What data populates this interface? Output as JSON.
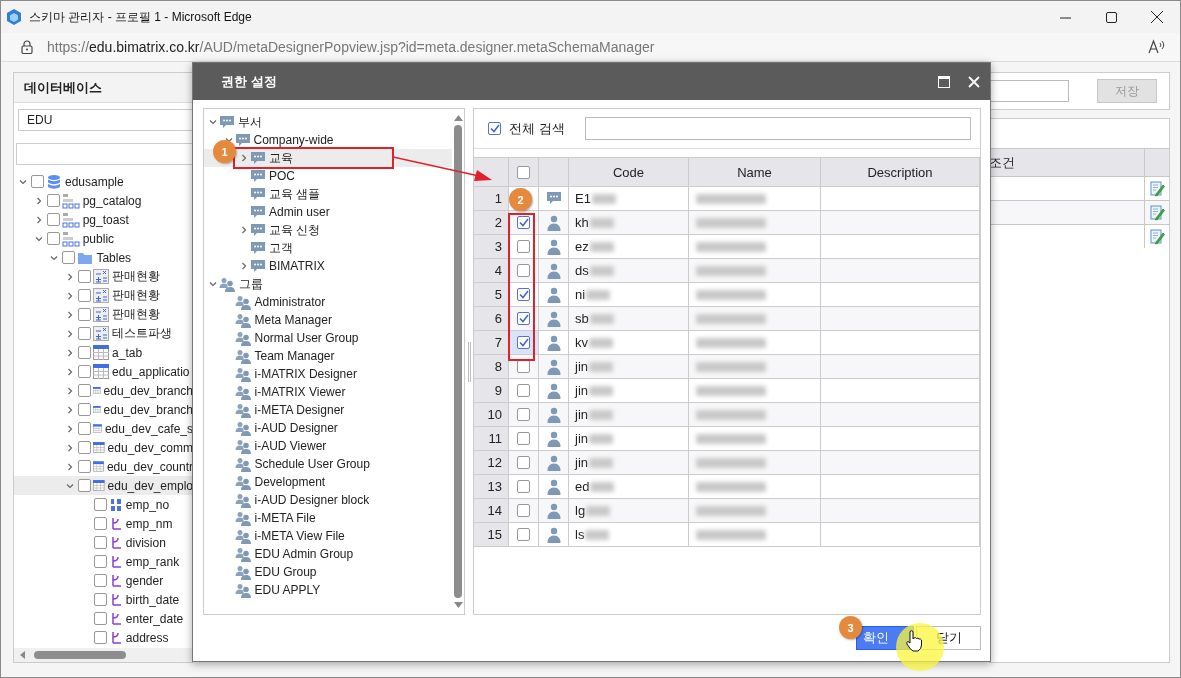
{
  "browser": {
    "title": "스키마 관리자 - 프로필 1 - Microsoft Edge",
    "url": {
      "scheme": "https://",
      "host": "edu.bimatrix.co.kr",
      "path": "/AUD/metaDesignerPopview.jsp?id=meta.designer.metaSchemaManager"
    }
  },
  "database_panel": {
    "title": "데이터베이스",
    "database": "EDU",
    "tree": [
      {
        "label": "edusample",
        "kind": "database",
        "checked": false,
        "expanded": true,
        "selected": false,
        "children": [
          {
            "label": "pg_catalog",
            "kind": "schema",
            "checked": false,
            "expanded": false,
            "selected": false
          },
          {
            "label": "pg_toast",
            "kind": "schema",
            "checked": false,
            "expanded": false,
            "selected": false
          },
          {
            "label": "public",
            "kind": "schema",
            "checked": false,
            "expanded": true,
            "selected": false,
            "children": [
              {
                "label": "Tables",
                "kind": "folder",
                "checked": false,
                "expanded": true,
                "selected": false,
                "children": [
                  {
                    "label": "판매현황",
                    "kind": "view",
                    "checked": false,
                    "expanded": false,
                    "selected": false
                  },
                  {
                    "label": "판매현황",
                    "kind": "view",
                    "checked": false,
                    "expanded": false,
                    "selected": false
                  },
                  {
                    "label": "판매현황",
                    "kind": "view",
                    "checked": false,
                    "expanded": false,
                    "selected": false
                  },
                  {
                    "label": "테스트파생",
                    "kind": "view",
                    "checked": false,
                    "expanded": false,
                    "selected": false
                  },
                  {
                    "label": "a_tab",
                    "kind": "table",
                    "checked": false,
                    "expanded": false,
                    "selected": false
                  },
                  {
                    "label": "edu_applicatio",
                    "kind": "table",
                    "checked": false,
                    "expanded": false,
                    "selected": false
                  },
                  {
                    "label": "edu_dev_branch",
                    "kind": "table",
                    "checked": false,
                    "expanded": false,
                    "selected": false
                  },
                  {
                    "label": "edu_dev_branch",
                    "kind": "table",
                    "checked": false,
                    "expanded": false,
                    "selected": false
                  },
                  {
                    "label": "edu_dev_cafe_s",
                    "kind": "table",
                    "checked": false,
                    "expanded": false,
                    "selected": false
                  },
                  {
                    "label": "edu_dev_comm",
                    "kind": "table",
                    "checked": false,
                    "expanded": false,
                    "selected": false
                  },
                  {
                    "label": "edu_dev_countr",
                    "kind": "table",
                    "checked": false,
                    "expanded": false,
                    "selected": false
                  },
                  {
                    "label": "edu_dev_emplo",
                    "kind": "table",
                    "checked": false,
                    "expanded": true,
                    "selected": true,
                    "children": [
                      {
                        "label": "emp_no",
                        "kind": "number",
                        "checked": false,
                        "selected": false
                      },
                      {
                        "label": "emp_nm",
                        "kind": "text",
                        "checked": false,
                        "selected": false
                      },
                      {
                        "label": "division",
                        "kind": "text",
                        "checked": false,
                        "selected": false
                      },
                      {
                        "label": "emp_rank",
                        "kind": "text",
                        "checked": false,
                        "selected": false
                      },
                      {
                        "label": "gender",
                        "kind": "text",
                        "checked": false,
                        "selected": false
                      },
                      {
                        "label": "birth_date",
                        "kind": "text",
                        "checked": false,
                        "selected": false
                      },
                      {
                        "label": "enter_date",
                        "kind": "text",
                        "checked": false,
                        "selected": false
                      },
                      {
                        "label": "address",
                        "kind": "text",
                        "checked": false,
                        "selected": false
                      }
                    ]
                  }
                ]
              }
            ]
          }
        ]
      }
    ]
  },
  "right_panel": {
    "save_button": "저장",
    "columns": [
      "조건"
    ],
    "rows": [
      {
        "editable": true
      },
      {
        "editable": true
      },
      {
        "editable": true
      }
    ]
  },
  "dialog": {
    "title": "권한 설정",
    "tree": [
      {
        "label": "부서",
        "kind": "department",
        "expanded": true,
        "selected": false,
        "children": [
          {
            "label": "Company-wide",
            "kind": "department",
            "expanded": true,
            "selected": false,
            "children": [
              {
                "label": "교육",
                "kind": "department",
                "expanded": false,
                "selected": true
              },
              {
                "label": "POC",
                "kind": "department",
                "selected": false
              },
              {
                "label": "교육 샘플",
                "kind": "department",
                "selected": false
              },
              {
                "label": "Admin user",
                "kind": "department",
                "selected": false
              },
              {
                "label": "교육 신청",
                "kind": "department",
                "expanded": false,
                "selected": false
              },
              {
                "label": "고객",
                "kind": "department",
                "selected": false
              },
              {
                "label": "BIMATRIX",
                "kind": "department",
                "expanded": false,
                "selected": false
              }
            ]
          }
        ]
      },
      {
        "label": "그룹",
        "kind": "group",
        "expanded": true,
        "selected": false,
        "children": [
          {
            "label": "Administrator",
            "kind": "group",
            "selected": false
          },
          {
            "label": "Meta Manager",
            "kind": "group",
            "selected": false
          },
          {
            "label": "Normal User Group",
            "kind": "group",
            "selected": false
          },
          {
            "label": "Team Manager",
            "kind": "group",
            "selected": false
          },
          {
            "label": "i-MATRIX Designer",
            "kind": "group",
            "selected": false
          },
          {
            "label": "i-MATRIX Viewer",
            "kind": "group",
            "selected": false
          },
          {
            "label": "i-META Designer",
            "kind": "group",
            "selected": false
          },
          {
            "label": "i-AUD Designer",
            "kind": "group",
            "selected": false
          },
          {
            "label": "i-AUD Viewer",
            "kind": "group",
            "selected": false
          },
          {
            "label": "Schedule User Group",
            "kind": "group",
            "selected": false
          },
          {
            "label": "Development",
            "kind": "group",
            "selected": false
          },
          {
            "label": "i-AUD Designer block",
            "kind": "group",
            "selected": false
          },
          {
            "label": "i-META File",
            "kind": "group",
            "selected": false
          },
          {
            "label": "i-META View File",
            "kind": "group",
            "selected": false
          },
          {
            "label": "EDU Admin Group",
            "kind": "group",
            "selected": false
          },
          {
            "label": "EDU Group",
            "kind": "group",
            "selected": false
          },
          {
            "label": "EDU APPLY",
            "kind": "group",
            "selected": false
          }
        ]
      }
    ],
    "search": {
      "label": "전체 검색",
      "checked": true
    },
    "columns": [
      "Code",
      "Name",
      "Description"
    ],
    "header_checked": false,
    "rows": [
      {
        "index": "1",
        "kind": "department",
        "code": "E1",
        "selected": false
      },
      {
        "index": "2",
        "kind": "user",
        "code": "kh",
        "checked": true,
        "selected": false
      },
      {
        "index": "3",
        "kind": "user",
        "code": "ez",
        "checked": false,
        "selected": false
      },
      {
        "index": "4",
        "kind": "user",
        "code": "ds",
        "checked": false,
        "selected": false
      },
      {
        "index": "5",
        "kind": "user",
        "code": "ni",
        "checked": true,
        "selected": false
      },
      {
        "index": "6",
        "kind": "user",
        "code": "sb",
        "checked": true,
        "selected": false
      },
      {
        "index": "7",
        "kind": "user",
        "code": "kv",
        "checked": true,
        "selected": true
      },
      {
        "index": "8",
        "kind": "user",
        "code": "jin",
        "checked": false,
        "selected": false
      },
      {
        "index": "9",
        "kind": "user",
        "code": "jin",
        "checked": false,
        "selected": false
      },
      {
        "index": "10",
        "kind": "user",
        "code": "jin",
        "checked": false,
        "selected": false
      },
      {
        "index": "11",
        "kind": "user",
        "code": "jin",
        "checked": false,
        "selected": false
      },
      {
        "index": "12",
        "kind": "user",
        "code": "jin",
        "checked": false,
        "selected": false
      },
      {
        "index": "13",
        "kind": "user",
        "code": "ed",
        "checked": false,
        "selected": false
      },
      {
        "index": "14",
        "kind": "user",
        "code": "lg",
        "checked": false,
        "selected": false
      },
      {
        "index": "15",
        "kind": "user",
        "code": "ls",
        "checked": false,
        "selected": false
      }
    ],
    "buttons": [
      {
        "label": "확인",
        "kind": "primary"
      },
      {
        "label": "닫기",
        "kind": "default"
      }
    ]
  },
  "annotations": [
    {
      "number": "1"
    },
    {
      "number": "2"
    },
    {
      "number": "3"
    }
  ]
}
